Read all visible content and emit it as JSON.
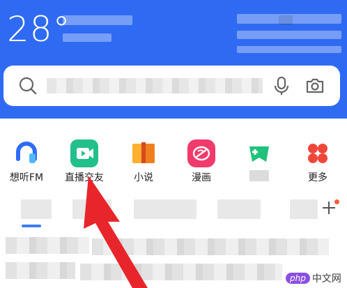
{
  "weather": {
    "temperature": "28°"
  },
  "search": {
    "mic_icon": "microphone-icon",
    "camera_icon": "camera-icon",
    "search_icon": "search-icon"
  },
  "shortcuts": [
    {
      "label": "想听FM",
      "icon": "headphones-icon",
      "color": "#2d6cf5"
    },
    {
      "label": "直播交友",
      "icon": "live-video-icon",
      "color": "#22c08a"
    },
    {
      "label": "小说",
      "icon": "book-icon",
      "color": "#f5a623"
    },
    {
      "label": "漫画",
      "icon": "comic-icon",
      "color": "#f03b6b"
    },
    {
      "label": "",
      "icon": "game-controller-icon",
      "color": "#1fc27a"
    },
    {
      "label": "更多",
      "icon": "more-grid-icon",
      "color": "#f0473a"
    }
  ],
  "watermark": {
    "badge": "php",
    "text": "中文网"
  },
  "colors": {
    "header": "#2f6bf2",
    "accent": "#3a7df5",
    "annotation_arrow": "#e8252a"
  }
}
